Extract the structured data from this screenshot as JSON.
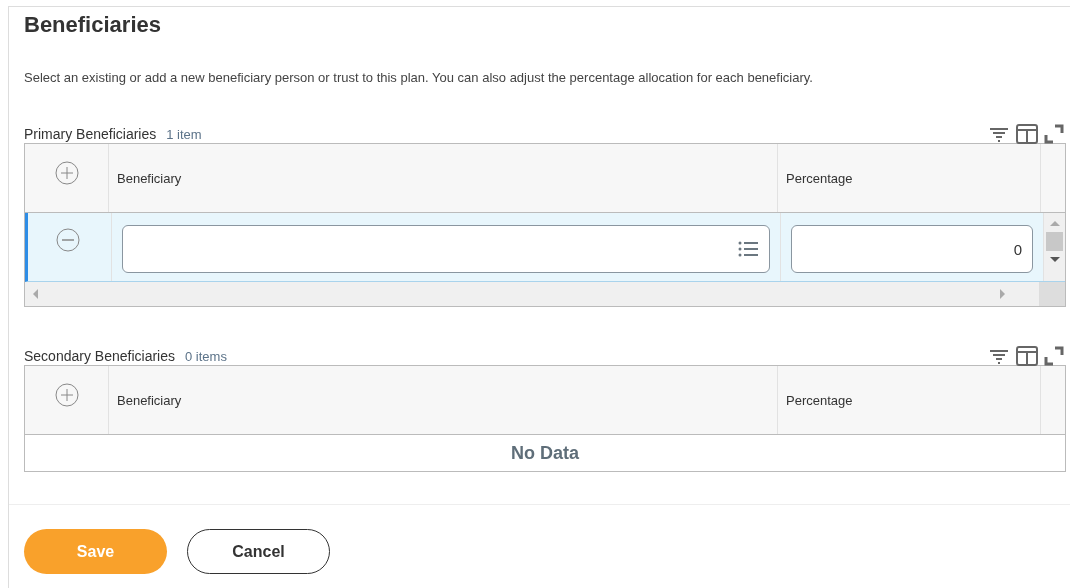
{
  "page": {
    "title": "Beneficiaries",
    "description": "Select an existing or add a new beneficiary person or trust to this plan. You can also adjust the percentage allocation for each beneficiary."
  },
  "sections": [
    {
      "title": "Primary Beneficiaries",
      "count": "1 item",
      "columns": [
        "Beneficiary",
        "Percentage"
      ],
      "rows": [
        {
          "percentage": "0",
          "selected": true
        }
      ]
    },
    {
      "title": "Secondary Beneficiaries",
      "count": "0 items",
      "columns": [
        "Beneficiary",
        "Percentage"
      ],
      "empty_message": "No Data"
    }
  ],
  "buttons": [
    {
      "label": "Save",
      "kind": "primary"
    },
    {
      "label": "Cancel",
      "kind": "secondary"
    }
  ]
}
